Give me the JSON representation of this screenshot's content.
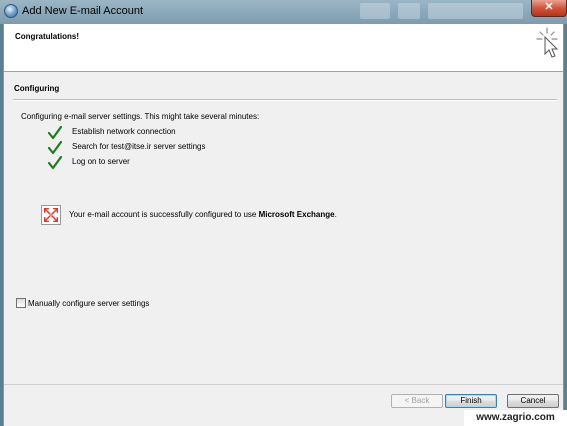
{
  "window": {
    "title": "Add New E-mail Account",
    "close_glyph": "✕"
  },
  "header": {
    "title": "Congratulations!",
    "icon": "wizard-sparkle-icon"
  },
  "section": {
    "label": "Configuring"
  },
  "progress": {
    "intro": "Configuring e-mail server settings. This might take several minutes:",
    "steps": [
      {
        "label": "Establish network connection",
        "status": "done"
      },
      {
        "label": "Search for test@itse.ir server settings",
        "status": "done"
      },
      {
        "label": "Log on to server",
        "status": "done"
      }
    ]
  },
  "result": {
    "text": "Your e-mail account is successfully configured to use ",
    "emphasis": "Microsoft Exchange",
    "suffix": ".",
    "icon": "exchange-icon"
  },
  "manual": {
    "label": "Manually configure server settings",
    "checked": false
  },
  "buttons": {
    "back": "< Back",
    "finish": "Finish",
    "cancel": "Cancel"
  },
  "watermark": "www.zagrio.com",
  "colors": {
    "check": "#1e7d1e",
    "exchange": "#d83b2a",
    "default_button_border": "#3c7fb1"
  }
}
